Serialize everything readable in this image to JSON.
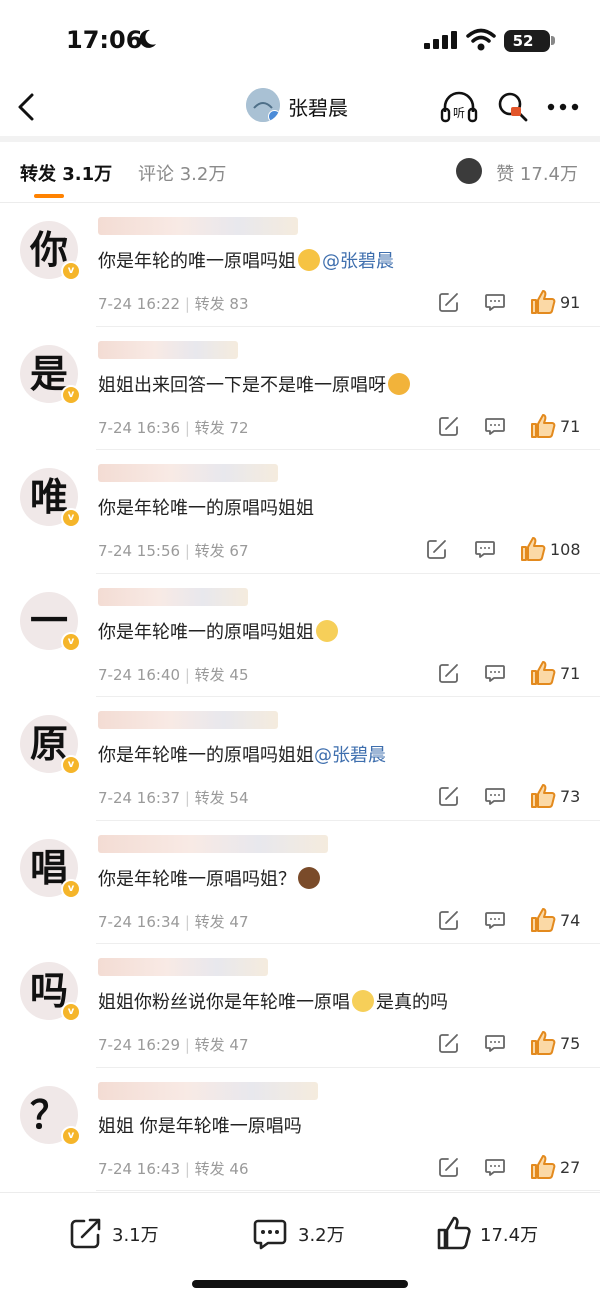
{
  "status_bar": {
    "time": "17:06",
    "battery": "52"
  },
  "nav": {
    "title": "张碧晨"
  },
  "tabs": {
    "repost_label": "转发",
    "repost_count": "3.1万",
    "comment_label": "评论",
    "comment_count": "3.2万",
    "like_label": "赞",
    "like_count": "17.4万"
  },
  "items": [
    {
      "avatar_char": "你",
      "text": "你是年轮的唯一原唱吗姐",
      "emoji": "laugh-emoji",
      "mention": "@张碧晨",
      "suffix": "",
      "date": "7-24 16:22",
      "repost": "转发 83",
      "likes": "91"
    },
    {
      "avatar_char": "是",
      "text": "姐姐出来回答一下是不是唯一原唱呀",
      "emoji": "cover-mouth-emoji",
      "mention": "",
      "suffix": "",
      "date": "7-24 16:36",
      "repost": "转发 72",
      "likes": "71"
    },
    {
      "avatar_char": "唯",
      "text": "你是年轮唯一的原唱吗姐姐",
      "emoji": "",
      "mention": "",
      "suffix": "",
      "date": "7-24 15:56",
      "repost": "转发 67",
      "likes": "108"
    },
    {
      "avatar_char": "一",
      "text": "你是年轮唯一的原唱吗姐姐",
      "emoji": "scared-emoji",
      "mention": "",
      "suffix": "",
      "date": "7-24 16:40",
      "repost": "转发 45",
      "likes": "71"
    },
    {
      "avatar_char": "原",
      "text": "你是年轮唯一的原唱吗姐姐",
      "emoji": "",
      "mention": "@张碧晨",
      "suffix": "",
      "date": "7-24 16:37",
      "repost": "转发 54",
      "likes": "73"
    },
    {
      "avatar_char": "唱",
      "text": "你是年轮唯一原唱吗姐？",
      "emoji": "poop-emoji",
      "mention": "",
      "suffix": "",
      "date": "7-24 16:34",
      "repost": "转发 47",
      "likes": "74"
    },
    {
      "avatar_char": "吗",
      "text": "姐姐你粉丝说你是年轮唯一原唱",
      "emoji": "scared-emoji",
      "mention": "",
      "suffix": "是真的吗",
      "date": "7-24 16:29",
      "repost": "转发 47",
      "likes": "75"
    },
    {
      "avatar_char": "？",
      "text": "姐姐 你是年轮唯一原唱吗",
      "emoji": "",
      "mention": "",
      "suffix": "",
      "date": "7-24 16:43",
      "repost": "转发 46",
      "likes": "27"
    }
  ],
  "bottom_bar": {
    "repost": "3.1万",
    "comment": "3.2万",
    "like": "17.4万"
  },
  "colors": {
    "accent": "#ff8200",
    "mention": "#3f6fae",
    "verified": "#f5b52a"
  }
}
